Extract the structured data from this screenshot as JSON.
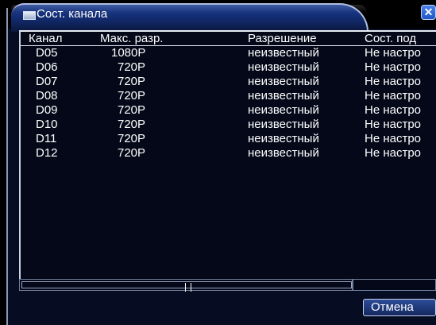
{
  "window": {
    "title": "Сост. канала",
    "close_symbol": "✕"
  },
  "table": {
    "columns": [
      "Канал",
      "Макс. разр.",
      "Разрешение",
      "Сост. под"
    ],
    "rows": [
      {
        "channel": "D05",
        "max_res": "1080P",
        "resolution": "неизвестный",
        "status": "Не настро"
      },
      {
        "channel": "D06",
        "max_res": "720P",
        "resolution": "неизвестный",
        "status": "Не настро"
      },
      {
        "channel": "D07",
        "max_res": "720P",
        "resolution": "неизвестный",
        "status": "Не настро"
      },
      {
        "channel": "D08",
        "max_res": "720P",
        "resolution": "неизвестный",
        "status": "Не настро"
      },
      {
        "channel": "D09",
        "max_res": "720P",
        "resolution": "неизвестный",
        "status": "Не настро"
      },
      {
        "channel": "D10",
        "max_res": "720P",
        "resolution": "неизвестный",
        "status": "Не настро"
      },
      {
        "channel": "D11",
        "max_res": "720P",
        "resolution": "неизвестный",
        "status": "Не настро"
      },
      {
        "channel": "D12",
        "max_res": "720P",
        "resolution": "неизвестный",
        "status": "Не настро"
      }
    ]
  },
  "buttons": {
    "cancel": "Отмена"
  },
  "icons": {
    "title": "window-icon",
    "close": "close-icon"
  },
  "colors": {
    "background": "#060c22",
    "title_bar": "#1d3f92",
    "text": "#ffffff",
    "border": "#e8ecf4"
  }
}
